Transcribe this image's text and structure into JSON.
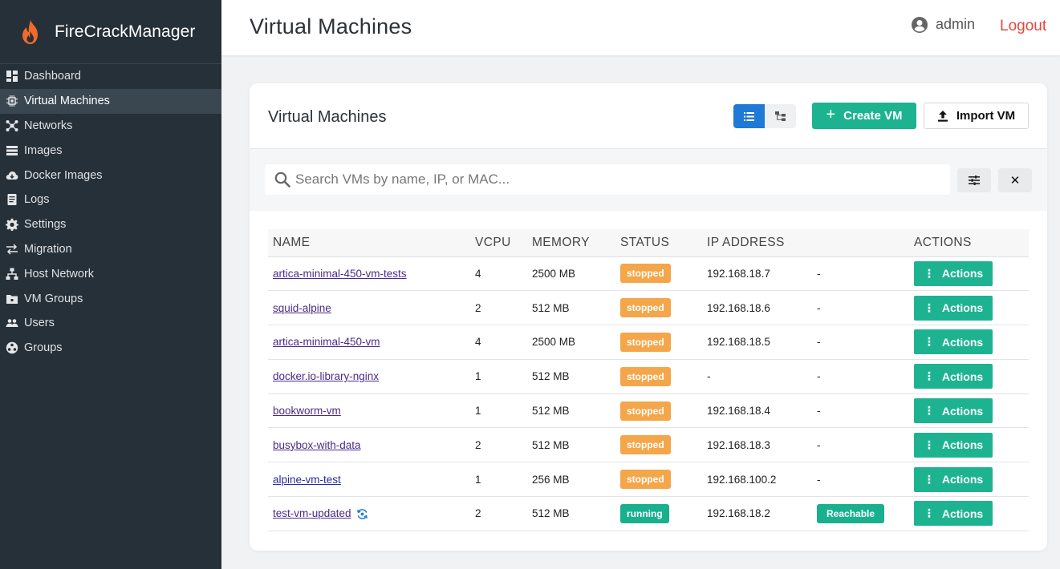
{
  "app": {
    "name": "FireCrackManager"
  },
  "sidebar": {
    "items": [
      {
        "label": "Dashboard",
        "icon": "dashboard-icon"
      },
      {
        "label": "Virtual Machines",
        "icon": "chip-icon",
        "active": true
      },
      {
        "label": "Networks",
        "icon": "network-icon"
      },
      {
        "label": "Images",
        "icon": "images-icon"
      },
      {
        "label": "Docker Images",
        "icon": "cloud-download-icon"
      },
      {
        "label": "Logs",
        "icon": "file-icon"
      },
      {
        "label": "Settings",
        "icon": "gear-icon"
      },
      {
        "label": "Migration",
        "icon": "swap-icon"
      },
      {
        "label": "Host Network",
        "icon": "sitemap-icon"
      },
      {
        "label": "VM Groups",
        "icon": "folder-icon"
      },
      {
        "label": "Users",
        "icon": "users-icon"
      },
      {
        "label": "Groups",
        "icon": "group-icon"
      }
    ]
  },
  "header": {
    "title": "Virtual Machines",
    "user": "admin",
    "logout": "Logout"
  },
  "card": {
    "title": "Virtual Machines",
    "create_label": "Create VM",
    "import_label": "Import VM",
    "search_placeholder": "Search VMs by name, IP, or MAC...",
    "clear_label": "✕"
  },
  "table": {
    "columns": [
      "NAME",
      "VCPU",
      "MEMORY",
      "STATUS",
      "IP ADDRESS",
      "",
      "ACTIONS"
    ],
    "rows": [
      {
        "name": "artica-minimal-450-vm-tests",
        "vcpu": "4",
        "memory": "2500 MB",
        "status": "stopped",
        "ip": "192.168.18.7",
        "reach": "-",
        "action": "Actions"
      },
      {
        "name": "squid-alpine",
        "vcpu": "2",
        "memory": "512 MB",
        "status": "stopped",
        "ip": "192.168.18.6",
        "reach": "-",
        "action": "Actions"
      },
      {
        "name": "artica-minimal-450-vm",
        "vcpu": "4",
        "memory": "2500 MB",
        "status": "stopped",
        "ip": "192.168.18.5",
        "reach": "-",
        "action": "Actions"
      },
      {
        "name": "docker.io-library-nginx",
        "vcpu": "1",
        "memory": "512 MB",
        "status": "stopped",
        "ip": "-",
        "reach": "-",
        "action": "Actions"
      },
      {
        "name": "bookworm-vm",
        "vcpu": "1",
        "memory": "512 MB",
        "status": "stopped",
        "ip": "192.168.18.4",
        "reach": "-",
        "action": "Actions"
      },
      {
        "name": "busybox-with-data",
        "vcpu": "2",
        "memory": "512 MB",
        "status": "stopped",
        "ip": "192.168.18.3",
        "reach": "-",
        "action": "Actions"
      },
      {
        "name": "alpine-vm-test",
        "vcpu": "1",
        "memory": "256 MB",
        "status": "stopped",
        "ip": "192.168.100.2",
        "reach": "-",
        "action": "Actions"
      },
      {
        "name": "test-vm-updated",
        "vcpu": "2",
        "memory": "512 MB",
        "status": "running",
        "ip": "192.168.18.2",
        "reach": "Reachable",
        "action": "Actions"
      }
    ]
  },
  "colors": {
    "sidebar": "#263038",
    "accent": "#1db391",
    "stopped": "#f4a64a",
    "logout": "#e8463c",
    "primary": "#1e7ad6"
  }
}
